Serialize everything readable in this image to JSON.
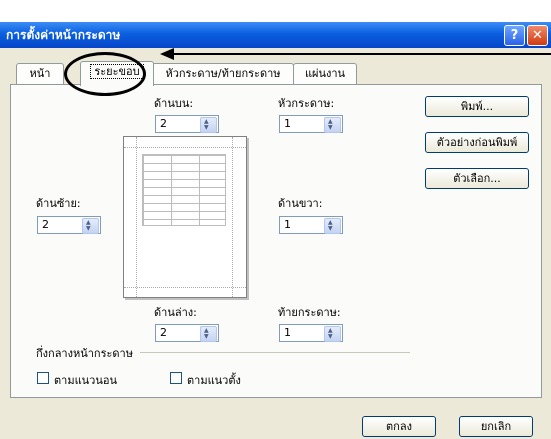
{
  "window": {
    "title": "การตั้งค่าหน้ากระดาษ",
    "help_glyph": "?",
    "close_glyph": "✕"
  },
  "tabs": [
    {
      "label": "หน้า"
    },
    {
      "label": "ระยะขอบ",
      "active": true
    },
    {
      "label": "หัวกระดาษ/ท้ายกระดาษ"
    },
    {
      "label": "แผ่นงาน"
    }
  ],
  "margins": {
    "top": {
      "label": "ด้านบน:",
      "value": "2"
    },
    "header": {
      "label": "หัวกระดาษ:",
      "value": "1"
    },
    "left": {
      "label": "ด้านซ้าย:",
      "value": "2"
    },
    "right": {
      "label": "ด้านขวา:",
      "value": "1"
    },
    "bottom": {
      "label": "ด้านล่าง:",
      "value": "2"
    },
    "footer": {
      "label": "ท้ายกระดาษ:",
      "value": "1"
    }
  },
  "center": {
    "group_label": "กึ่งกลางหน้ากระดาษ",
    "horizontal_label": "ตามแนวนอน",
    "vertical_label": "ตามแนวตั้ง"
  },
  "side_buttons": {
    "print": "พิมพ์...",
    "preview": "ตัวอย่างก่อนพิมพ์",
    "options": "ตัวเลือก..."
  },
  "footer_buttons": {
    "ok": "ตกลง",
    "cancel": "ยกเลิก"
  },
  "annotation": {
    "color": "#000000"
  }
}
